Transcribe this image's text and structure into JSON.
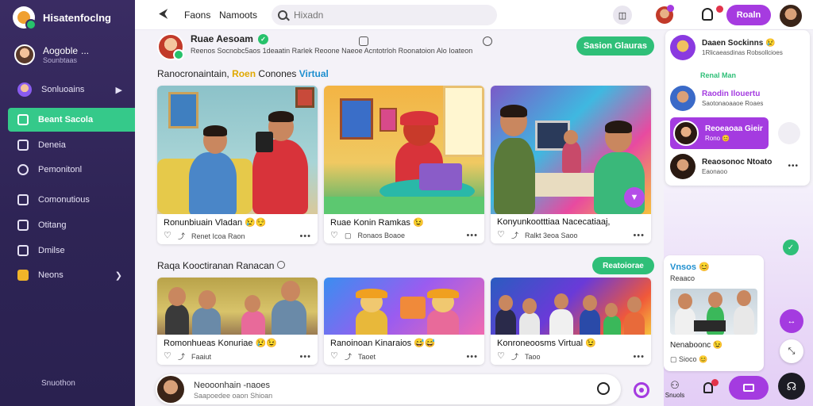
{
  "app": {
    "brand": "Hisatenfoclng"
  },
  "sidebar": {
    "user": {
      "name": "Aogoble",
      "sub": "Sounbtaas",
      "more": "..."
    },
    "items": [
      {
        "label": "Sonluoains"
      },
      {
        "label": "Beant Sacola"
      },
      {
        "label": "Deneia"
      },
      {
        "label": "Pemonitonl"
      },
      {
        "label": "Comonutious"
      },
      {
        "label": "Otitang"
      },
      {
        "label": "Dmilse"
      },
      {
        "label": "Neons"
      }
    ],
    "footer": "Snuothon"
  },
  "topbar": {
    "tabs": [
      "Faons",
      "Namoots"
    ],
    "search_placeholder": "Hixadn",
    "cta": "Roaln"
  },
  "post": {
    "author": "Ruae Aesoam",
    "meta": "Reenos Socnobc5aos 1deaatin Rarlek Reoone Naeoe Acntotrloh Roonatoion Alo Ioateon"
  },
  "follow_label": "Sasion  Glauras",
  "section1": {
    "prefix": "Ranocronaintain, ",
    "hl1": "Roen",
    "mid": " Conones ",
    "hl2": "Virtual"
  },
  "cards_row1": [
    {
      "caption": "Ronunbiuain Vladan 😢😌",
      "foot": "Renet Icoa Raon"
    },
    {
      "caption": "Ruae Konin Ramkas 😉",
      "foot": "Ronaos Boaoe"
    },
    {
      "caption": "Konyunkootttiaa Nacecatiaaj,",
      "foot": "Ralkt 3eoa Saoo"
    }
  ],
  "section2": {
    "title": "Raqa Kooctiranan Ranacan"
  },
  "section2_btn": "Reatoiorae",
  "cards_row2": [
    {
      "caption": "Romonhueas Konuriae 😢😉",
      "foot": "Faaiut"
    },
    {
      "caption": "Ranoinoan Kinaraios 😅😅",
      "foot": "Taoet"
    },
    {
      "caption": "Konroneoosms Virtual 😉",
      "foot": "Taoo"
    }
  ],
  "right_panel": {
    "items": [
      {
        "name": "Daaen Sockinns 😢",
        "sub": "1Rlicaeasdinas Robsollcioes"
      },
      {
        "name": "Raodin Ilouertu",
        "sub": "Saotonaoaaoe Roaes"
      },
      {
        "name": "Reoeaoaa Gieir",
        "sub": "Rono 😊"
      },
      {
        "name": "Reaosonoc Ntoato",
        "sub": "Eaonaoo"
      }
    ],
    "link": "Renal Man"
  },
  "right_card": {
    "title": "Vnsos 😊",
    "sub": "Reaaco",
    "caption": "Nenaboonc 😉",
    "foot": "Sioco 😊"
  },
  "composer": {
    "line1": "Neooonhain -naoes",
    "line2": "Saapoedee oaon Shioan"
  },
  "bottom": {
    "people_label": "Snuols"
  }
}
